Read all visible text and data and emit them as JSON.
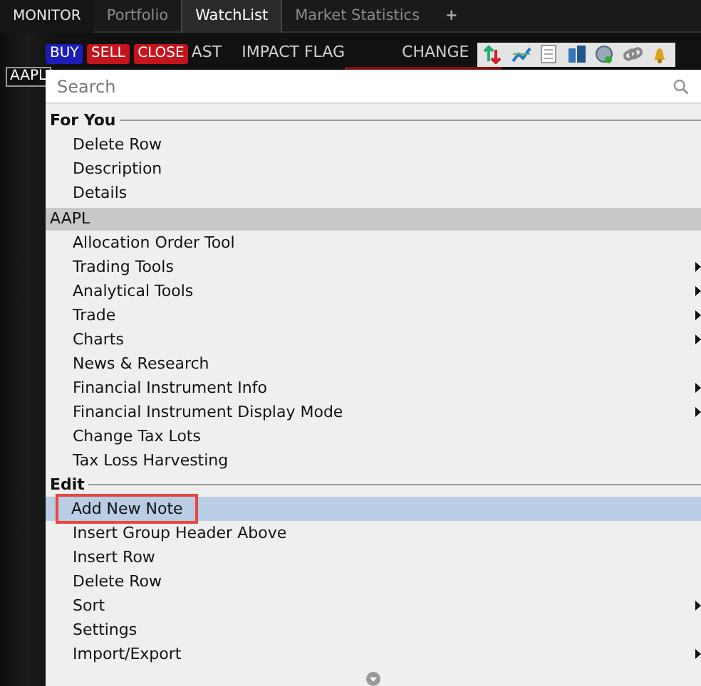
{
  "tabs": [
    {
      "label": "MONITOR",
      "selected": false,
      "kind": "app"
    },
    {
      "label": "Portfolio",
      "selected": false,
      "kind": "tab"
    },
    {
      "label": "WatchList",
      "selected": true,
      "kind": "tab"
    },
    {
      "label": "Market Statistics",
      "selected": false,
      "kind": "tab"
    },
    {
      "label": "+",
      "selected": false,
      "kind": "add"
    }
  ],
  "order_buttons": [
    {
      "label": "BUY",
      "color": "#1c1cb8"
    },
    {
      "label": "SELL",
      "color": "#c4141c"
    },
    {
      "label": "CLOSE",
      "color": "#c4141c"
    }
  ],
  "columns": [
    "AST",
    "IMPACT FLAG",
    "CHANGE"
  ],
  "row": {
    "symbol": "AAPL"
  },
  "menu": {
    "search": {
      "placeholder": "Search"
    },
    "sections": [
      {
        "title": "For You",
        "kind": "plain",
        "items": [
          {
            "label": "Delete Row",
            "submenu": false,
            "selected": false
          },
          {
            "label": "Description",
            "submenu": false,
            "selected": false
          },
          {
            "label": "Details",
            "submenu": false,
            "selected": false
          }
        ]
      },
      {
        "title": "AAPL",
        "kind": "bar",
        "items": [
          {
            "label": "Allocation Order Tool",
            "submenu": false,
            "selected": false
          },
          {
            "label": "Trading Tools",
            "submenu": true,
            "selected": false
          },
          {
            "label": "Analytical Tools",
            "submenu": true,
            "selected": false
          },
          {
            "label": "Trade",
            "submenu": true,
            "selected": false
          },
          {
            "label": "Charts",
            "submenu": true,
            "selected": false
          },
          {
            "label": "News & Research",
            "submenu": false,
            "selected": false
          },
          {
            "label": "Financial Instrument Info",
            "submenu": true,
            "selected": false
          },
          {
            "label": "Financial Instrument Display Mode",
            "submenu": true,
            "selected": false
          },
          {
            "label": "Change Tax Lots",
            "submenu": false,
            "selected": false
          },
          {
            "label": "Tax Loss Harvesting",
            "submenu": false,
            "selected": false
          }
        ]
      },
      {
        "title": "Edit",
        "kind": "plain",
        "items": [
          {
            "label": "Add New Note",
            "submenu": false,
            "selected": true
          },
          {
            "label": "Insert Group Header Above",
            "submenu": false,
            "selected": false
          },
          {
            "label": "Insert Row",
            "submenu": false,
            "selected": false
          },
          {
            "label": "Delete Row",
            "submenu": false,
            "selected": false
          },
          {
            "label": "Sort",
            "submenu": true,
            "selected": false
          },
          {
            "label": "Settings",
            "submenu": false,
            "selected": false
          },
          {
            "label": "Import/Export",
            "submenu": true,
            "selected": false
          }
        ]
      }
    ]
  }
}
